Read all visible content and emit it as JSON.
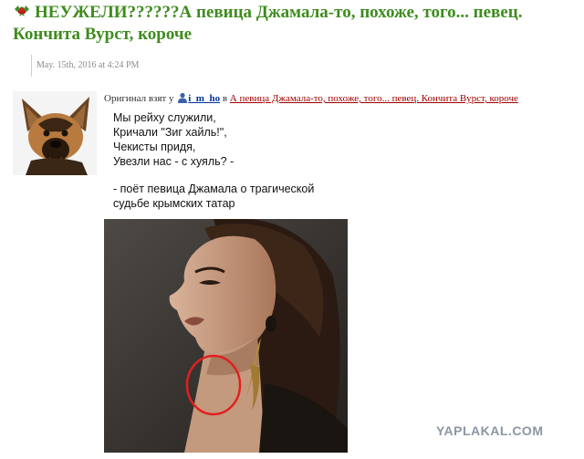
{
  "post": {
    "title": "НЕУЖЕЛИ??????А певица Джамала-то, похоже, того... певец. Кончита Вурст, короче",
    "date": "May. 15th, 2016 at 4:24 PM"
  },
  "source": {
    "prefix": "Оригинал взят у",
    "username": "i_m_ho",
    "in": "в",
    "link_text": "А певица Джамала-то, похоже, того... певец. Кончита Вурст, короче"
  },
  "meme": {
    "lines": [
      "Мы рейху служили,",
      "Кричали \"Зиг хайль!\",",
      "Чекисты придя,",
      "Увезли нас - с хуяль? -"
    ],
    "caption_lines": [
      "- поёт певица Джамала о трагической",
      "судьбе крымских татар"
    ]
  },
  "icons": {
    "title": "holly-icon",
    "user": "user-icon"
  },
  "colors": {
    "title": "#3e8c1e",
    "username": "#003399",
    "post_link": "#a00000",
    "highlight_circle": "#e02020"
  },
  "watermark": "YAPLAKAL.COM"
}
